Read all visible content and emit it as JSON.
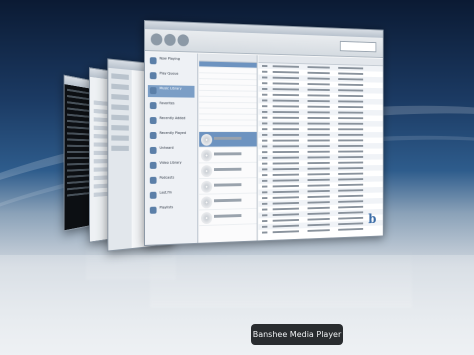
{
  "caption": "Banshee Media Player",
  "main_window": {
    "sources": [
      {
        "label": "Now Playing",
        "icon": "play-icon"
      },
      {
        "label": "Play Queue",
        "icon": "queue-icon"
      },
      {
        "label": "Music Library",
        "icon": "music-icon",
        "selected": true
      },
      {
        "label": "Favorites",
        "icon": "star-icon"
      },
      {
        "label": "Recently Added",
        "icon": "clock-icon"
      },
      {
        "label": "Recently Played",
        "icon": "history-icon"
      },
      {
        "label": "Unheard",
        "icon": "note-icon"
      },
      {
        "label": "Video Library",
        "icon": "video-icon"
      },
      {
        "label": "Podcasts",
        "icon": "podcast-icon"
      },
      {
        "label": "Last.fm",
        "icon": "lastfm-icon"
      },
      {
        "label": "Playlists",
        "icon": "list-icon"
      }
    ],
    "logo_text": "b"
  },
  "colors": {
    "selection": "#6d93c0",
    "sidebar": "#eef1f5",
    "caption_bg": "#14161a"
  }
}
